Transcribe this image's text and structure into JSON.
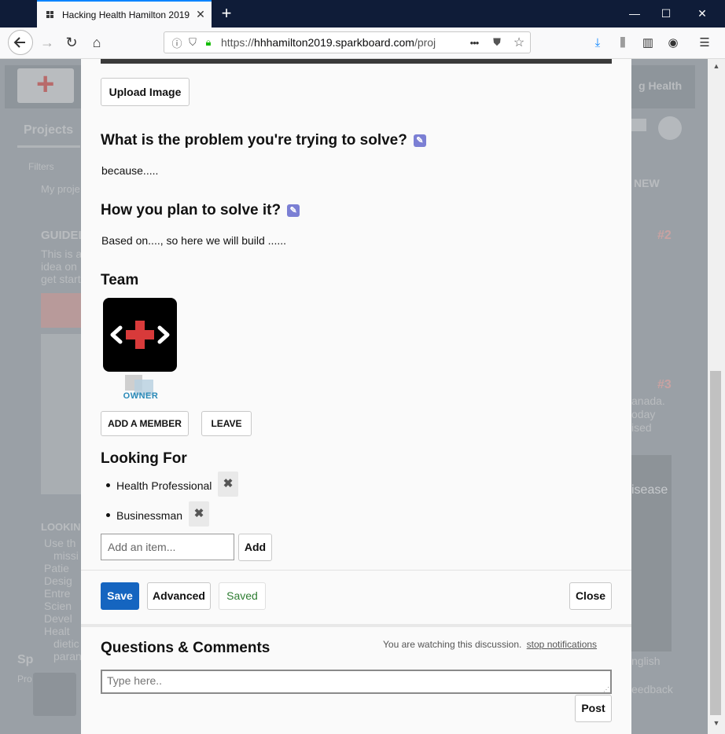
{
  "browser": {
    "tab_title": "Hacking Health Hamilton 2019",
    "url_prefix": "https://",
    "url_host": "hhhamilton2019.sparkboard.com",
    "url_path": "/proj",
    "more_dots": "•••"
  },
  "background": {
    "projects_tab": "Projects",
    "filters": "Filters",
    "my_projects": "My proje",
    "guidelines": "GUIDEL",
    "guide_text_1": "This is a",
    "guide_text_2": "idea on",
    "guide_text_3": "get start",
    "looking": "LOOKIN",
    "list": [
      "Use th",
      "missi",
      "Patie",
      "Desig",
      "Entre",
      "Scien",
      "Devel",
      "Healt",
      "dietic",
      "paran"
    ],
    "new_btn": "NEW",
    "health_banner": "g Health",
    "num2": "#2",
    "num3": "#3",
    "canada": "anada.",
    "today": "oday",
    "ised": "ised",
    "disease": "isease",
    "english": "nglish",
    "feedback": "eedback",
    "sp": "Sp",
    "pr": "Pro"
  },
  "modal": {
    "upload_label": "Upload Image",
    "problem_heading": "What is the problem you're trying to solve?",
    "problem_text": "because.....",
    "solve_heading": "How you plan to solve it?",
    "solve_text": "Based on...., so here we will build ......",
    "team_heading": "Team",
    "owner_label": "OWNER",
    "add_member_label": "ADD A MEMBER",
    "leave_label": "LEAVE",
    "looking_heading": "Looking For",
    "looking_items": [
      "Health Professional",
      "Businessman"
    ],
    "add_item_placeholder": "Add an item...",
    "add_label": "Add",
    "save_label": "Save",
    "advanced_label": "Advanced",
    "saved_label": "Saved",
    "close_label": "Close",
    "comments_heading": "Questions & Comments",
    "watching_text": "You are watching this discussion.",
    "stop_notifications": "stop notifications",
    "comment_placeholder": "Type here..",
    "post_label": "Post"
  },
  "colors": {
    "save_bg": "#1565c0",
    "saved_text": "#2e7d32",
    "pencil": "#7b7fd4",
    "owner": "#2a8ab8"
  }
}
